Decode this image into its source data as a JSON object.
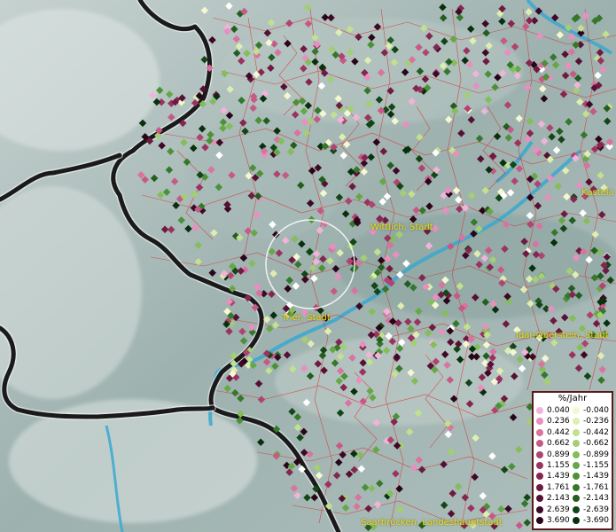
{
  "labels": {
    "wittlich": "Wittlich, Stadt",
    "trier": "Trier, Stadt",
    "idar": "Idar-Oberstein, Stadt",
    "kastellaun": "Kastela",
    "saarbruecken": "Saarbrücken, Landeshauptstadt"
  },
  "legend": {
    "title": "%/Jahr",
    "positive": [
      {
        "value": "0.040",
        "color": "#f2b3d8"
      },
      {
        "value": "0.236",
        "color": "#e88fc0"
      },
      {
        "value": "0.442",
        "color": "#d9739f"
      },
      {
        "value": "0.662",
        "color": "#c65a86"
      },
      {
        "value": "0.899",
        "color": "#b04470"
      },
      {
        "value": "1.155",
        "color": "#9a3360"
      },
      {
        "value": "1.439",
        "color": "#842650"
      },
      {
        "value": "1.761",
        "color": "#6e1a42"
      },
      {
        "value": "2.143",
        "color": "#561034"
      },
      {
        "value": "2.639",
        "color": "#3e0826"
      },
      {
        "value": "3.690",
        "color": "#2a0418"
      }
    ],
    "negative": [
      {
        "value": "-0.040",
        "color": "#f5f7d0"
      },
      {
        "value": "-0.236",
        "color": "#dfeeb0"
      },
      {
        "value": "-0.442",
        "color": "#c3e08e"
      },
      {
        "value": "-0.662",
        "color": "#a3cf72"
      },
      {
        "value": "-0.899",
        "color": "#84bd5a"
      },
      {
        "value": "-1.155",
        "color": "#66a847"
      },
      {
        "value": "-1.439",
        "color": "#4c9138"
      },
      {
        "value": "-1.761",
        "color": "#35782b"
      },
      {
        "value": "-2.143",
        "color": "#225e20"
      },
      {
        "value": "-2.639",
        "color": "#134616"
      },
      {
        "value": "-3.690",
        "color": "#07300c"
      }
    ]
  },
  "colors": {
    "border": "#1a1a1a",
    "admin_lines": "#d83030",
    "river": "#3aa8d0",
    "terrain": "#9fb6b4",
    "search_circle": "#ffffff"
  }
}
